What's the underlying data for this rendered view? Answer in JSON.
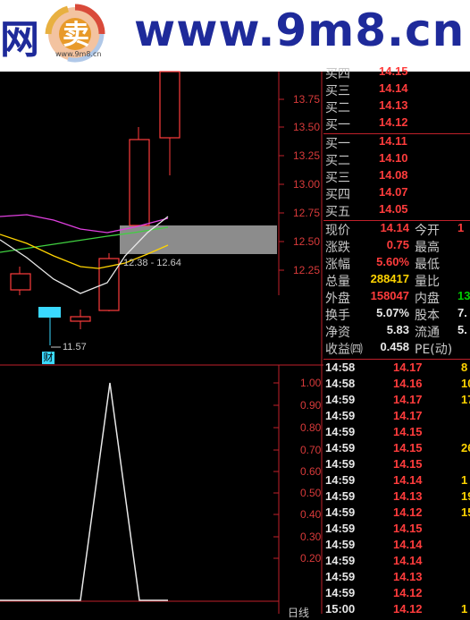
{
  "watermark": {
    "left_char": "网",
    "logo_char": "卖",
    "logo_sub": "www.9m8.cn",
    "url": "www.9m8.cn"
  },
  "colors": {
    "up": "#ff3c3c",
    "down": "#3ad9ff",
    "gold": "#ffd400",
    "green": "#00d000",
    "axis_red": "#c0202a"
  },
  "main_chart": {
    "price_ticks": [
      "13.75",
      "13.50",
      "13.25",
      "13.00",
      "12.75",
      "12.50",
      "12.25"
    ],
    "range_label": "12.38 - 12.64",
    "low_label": "11.57",
    "finance_badge": "财"
  },
  "indicator_chart": {
    "ticks": [
      "1.00",
      "0.90",
      "0.80",
      "0.70",
      "0.60",
      "0.50",
      "0.40",
      "0.30",
      "0.20"
    ],
    "period_label": "日线"
  },
  "order_book": {
    "buy": [
      {
        "label": "买四",
        "price": "14.15"
      },
      {
        "label": "买三",
        "price": "14.14"
      },
      {
        "label": "买二",
        "price": "14.13"
      },
      {
        "label": "买一",
        "price": "14.12"
      },
      {
        "label": "买一",
        "price": "14.11"
      },
      {
        "label": "买二",
        "price": "14.10"
      },
      {
        "label": "买三",
        "price": "14.08"
      },
      {
        "label": "买四",
        "price": "14.07"
      },
      {
        "label": "买五",
        "price": "14.05"
      }
    ]
  },
  "quote": {
    "rows": [
      {
        "l": "现价",
        "v": "14.14",
        "vc": "#ff3c3c",
        "l2": "今开",
        "v2": "1",
        "v2c": "#ff3c3c"
      },
      {
        "l": "涨跌",
        "v": "0.75",
        "vc": "#ff3c3c",
        "l2": "最高",
        "v2": "",
        "v2c": "#ff3c3c"
      },
      {
        "l": "涨幅",
        "v": "5.60%",
        "vc": "#ff3c3c",
        "l2": "最低",
        "v2": "",
        "v2c": "#ff3c3c"
      },
      {
        "l": "总量",
        "v": "288417",
        "vc": "#ffd400",
        "l2": "量比",
        "v2": "",
        "v2c": "#ff3c3c"
      },
      {
        "l": "外盘",
        "v": "158047",
        "vc": "#ff3c3c",
        "l2": "内盘",
        "v2": "13",
        "v2c": "#00d000"
      },
      {
        "l": "换手",
        "v": "5.07%",
        "vc": "#e8e8e8",
        "l2": "股本",
        "v2": "7.",
        "v2c": "#e8e8e8"
      },
      {
        "l": "净资",
        "v": "5.83",
        "vc": "#e8e8e8",
        "l2": "流通",
        "v2": "5.",
        "v2c": "#e8e8e8"
      },
      {
        "l": "收益㈣",
        "v": "0.458",
        "vc": "#e8e8e8",
        "l2": "PE(动)",
        "v2": "",
        "v2c": "#e8e8e8"
      }
    ]
  },
  "ticks": [
    {
      "t": "14:58",
      "p": "14.17",
      "pc": "#ff3c3c",
      "v": "8",
      "vc": "#ffd400"
    },
    {
      "t": "14:58",
      "p": "14.16",
      "pc": "#ff3c3c",
      "v": "10",
      "vc": "#ffd400"
    },
    {
      "t": "14:59",
      "p": "14.17",
      "pc": "#ff3c3c",
      "v": "17",
      "vc": "#ffd400"
    },
    {
      "t": "14:59",
      "p": "14.17",
      "pc": "#ff3c3c",
      "v": "",
      "vc": "#ffd400"
    },
    {
      "t": "14:59",
      "p": "14.15",
      "pc": "#ff3c3c",
      "v": "",
      "vc": "#ffd400"
    },
    {
      "t": "14:59",
      "p": "14.15",
      "pc": "#ff3c3c",
      "v": "26",
      "vc": "#ffd400"
    },
    {
      "t": "14:59",
      "p": "14.15",
      "pc": "#ff3c3c",
      "v": "",
      "vc": "#ffd400"
    },
    {
      "t": "14:59",
      "p": "14.14",
      "pc": "#ff3c3c",
      "v": "1",
      "vc": "#ffd400"
    },
    {
      "t": "14:59",
      "p": "14.13",
      "pc": "#ff3c3c",
      "v": "19",
      "vc": "#ffd400"
    },
    {
      "t": "14:59",
      "p": "14.12",
      "pc": "#ff3c3c",
      "v": "15",
      "vc": "#ffd400"
    },
    {
      "t": "14:59",
      "p": "14.15",
      "pc": "#ff3c3c",
      "v": "",
      "vc": "#ffd400"
    },
    {
      "t": "14:59",
      "p": "14.14",
      "pc": "#ff3c3c",
      "v": "",
      "vc": "#ffd400"
    },
    {
      "t": "14:59",
      "p": "14.14",
      "pc": "#ff3c3c",
      "v": "",
      "vc": "#ffd400"
    },
    {
      "t": "14:59",
      "p": "14.13",
      "pc": "#ff3c3c",
      "v": "",
      "vc": "#ffd400"
    },
    {
      "t": "14:59",
      "p": "14.12",
      "pc": "#ff3c3c",
      "v": "",
      "vc": "#ffd400"
    },
    {
      "t": "15:00",
      "p": "14.12",
      "pc": "#ff3c3c",
      "v": "1",
      "vc": "#ffd400"
    }
  ]
}
